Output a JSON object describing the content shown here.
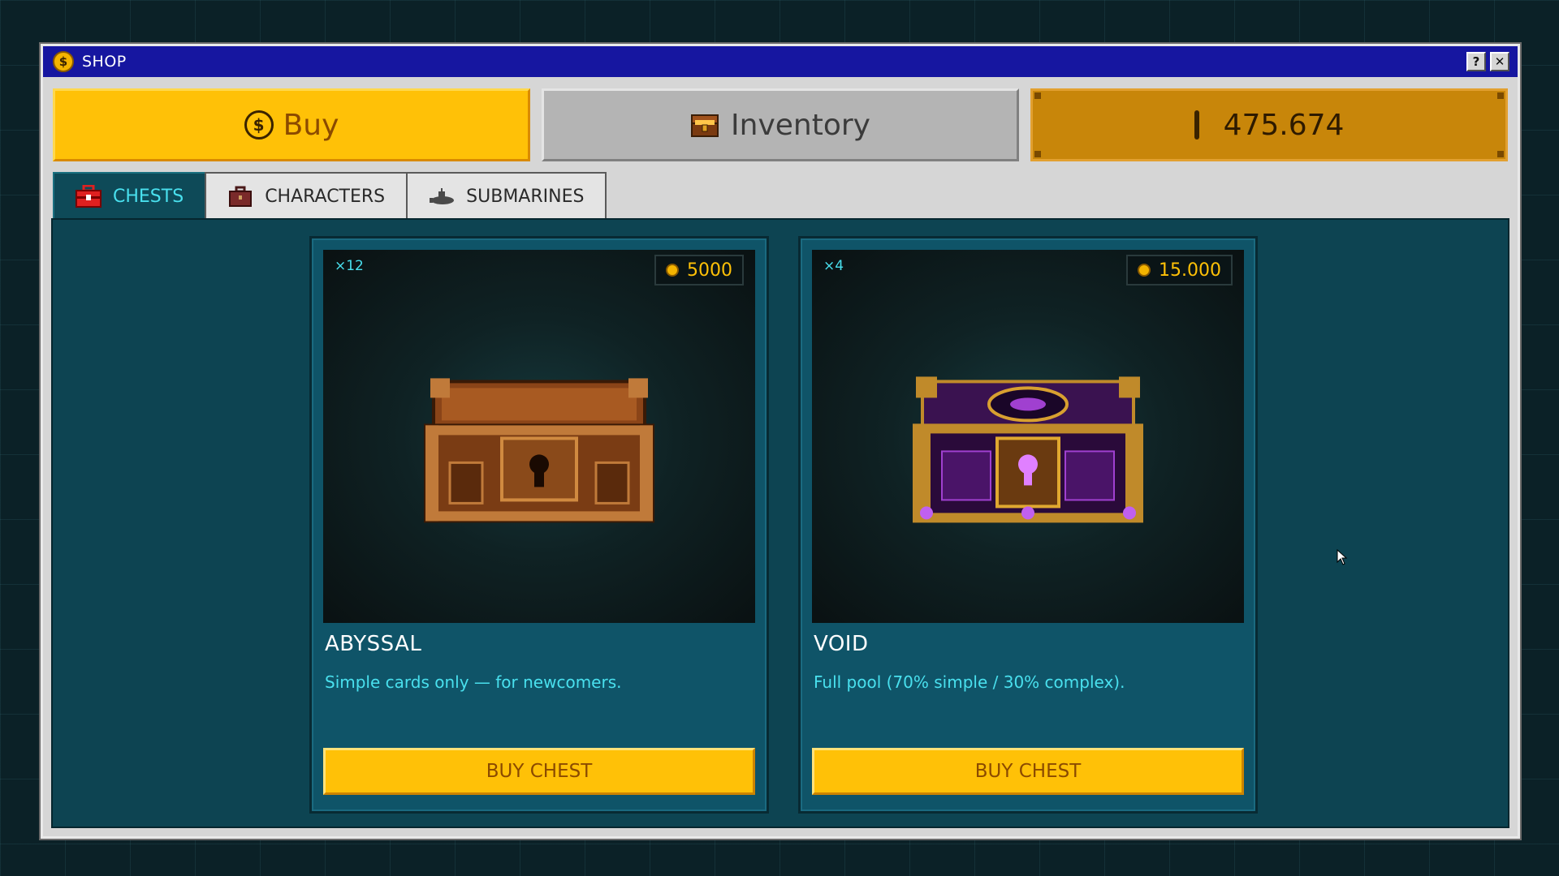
{
  "window": {
    "title": "SHOP",
    "help_label": "?",
    "close_label": "✕"
  },
  "topbar": {
    "buy_label": "Buy",
    "inventory_label": "Inventory",
    "balance": "475.674"
  },
  "tabs": [
    {
      "label": "CHESTS",
      "active": true
    },
    {
      "label": "CHARACTERS",
      "active": false
    },
    {
      "label": "SUBMARINES",
      "active": false
    }
  ],
  "cards": [
    {
      "quantity": "×12",
      "price": "5000",
      "name": "ABYSSAL",
      "description": "Simple cards only — for newcomers.",
      "button_label": "BUY CHEST"
    },
    {
      "quantity": "×4",
      "price": "15.000",
      "name": "VOID",
      "description": "Full pool (70% simple / 30% complex).",
      "button_label": "BUY CHEST"
    }
  ],
  "colors": {
    "accent_yellow": "#ffc107",
    "title_bar": "#1616a0",
    "cyan_text": "#49e0ee",
    "panel": "#0d4452"
  },
  "icons": {
    "title": "coin-icon",
    "buy": "coin-icon",
    "inventory": "chest-icon",
    "balance": "coin-edge-icon",
    "tab_chests": "toolbox-icon",
    "tab_characters": "briefcase-icon",
    "tab_submarines": "submarine-icon"
  }
}
